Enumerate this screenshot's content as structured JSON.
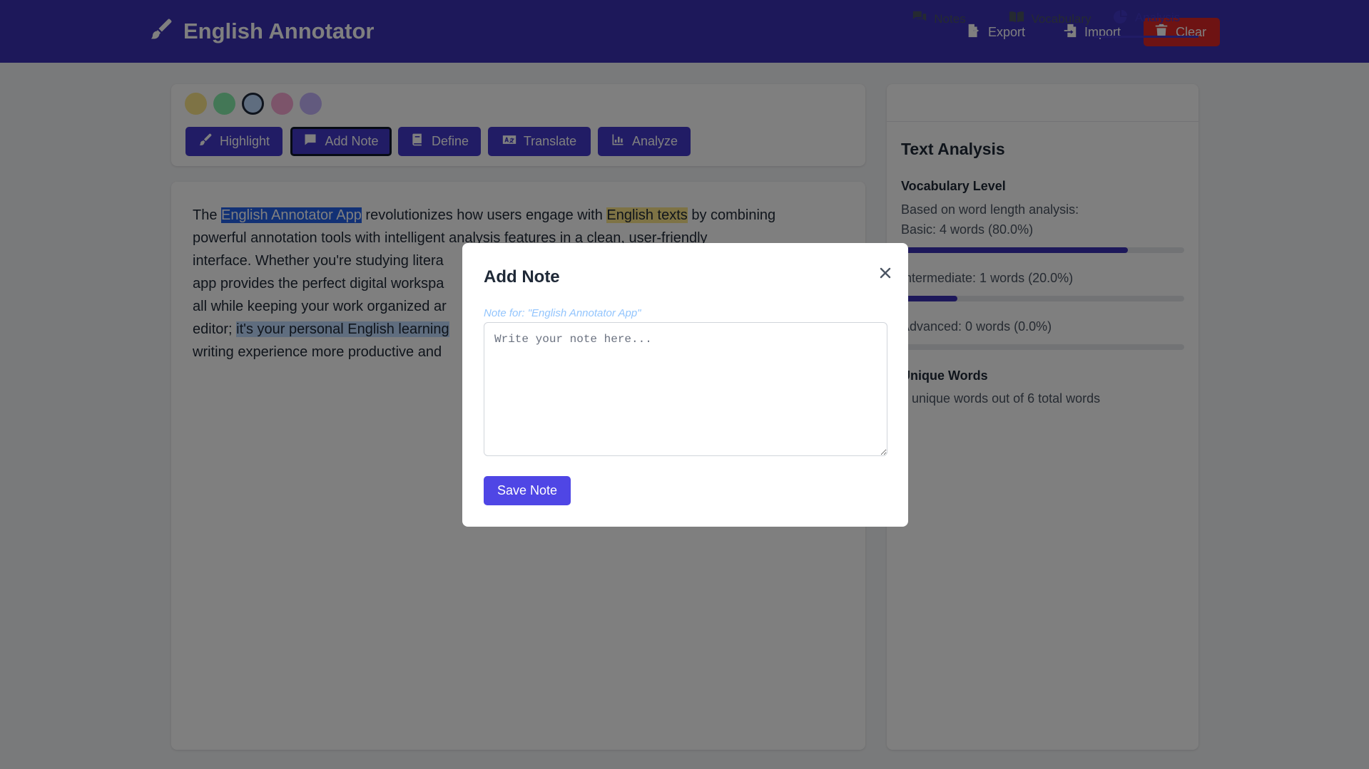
{
  "header": {
    "app_title": "English Annotator",
    "logo_icon": "brush-icon",
    "export_label": "Export",
    "import_label": "Import",
    "clear_label": "Clear"
  },
  "toolbar": {
    "colors": [
      "#fde68a",
      "#86efac",
      "#bfdbfe",
      "#f9a8d4",
      "#c4b5fd"
    ],
    "selected_color": "#bfdbfe",
    "highlight_label": "Highlight",
    "add_note_label": "Add Note",
    "define_label": "Define",
    "translate_label": "Translate",
    "analyze_label": "Analyze"
  },
  "document": {
    "segments": [
      {
        "text": "The ",
        "style": "plain"
      },
      {
        "text": "English Annotator App",
        "style": "selected"
      },
      {
        "text": " revolutionizes how users engage with ",
        "style": "plain"
      },
      {
        "text": "English texts",
        "style": "yellow"
      },
      {
        "text": " by combining powerful annotation tools with intelligent analysis features in a clean, user-friendly interface. Whether you're studying litera",
        "style": "plain"
      },
      {
        "text": " app provides the perfect digital workspa",
        "style": "plain"
      },
      {
        "text": " all while keeping your work organized ar",
        "style": "plain"
      },
      {
        "text": " editor; ",
        "style": "plain"
      },
      {
        "text": "it's your personal English learning",
        "style": "blue"
      },
      {
        "text": " writing experience more productive and",
        "style": "plain"
      }
    ],
    "line1_a": "The ",
    "line1_sel": "English Annotator App",
    "line1_b": " revolutionizes how users engage with ",
    "line1_yellow": "English texts",
    "line1_c": " by combining",
    "line2": "powerful annotation tools with intelligent analysis features in a clean, user-friendly",
    "line3": "interface. Whether you're studying litera",
    "line4": "app provides the perfect digital workspa",
    "line5": "all while keeping your work organized ar",
    "line6_a": "editor; ",
    "line6_blue": "it's your personal English learning",
    "line7": "writing experience more productive and"
  },
  "panel": {
    "tabs": [
      {
        "label": "Notes",
        "icon": "comments-icon"
      },
      {
        "label": "Vocabulary",
        "icon": "book-open-icon"
      },
      {
        "label": "Analysis",
        "icon": "chart-pie-icon",
        "active": true
      }
    ],
    "title": "Text Analysis",
    "vocab_title": "Vocabulary Level",
    "vocab_intro": "Based on word length analysis:",
    "basic_text": "Basic: 4 words (80.0%)",
    "basic_pct": 80.0,
    "intermediate_text": "Intermediate: 1 words (20.0%)",
    "intermediate_pct": 20.0,
    "advanced_text": "Advanced: 0 words (0.0%)",
    "advanced_pct": 0.0,
    "unique_title": "Unique Words",
    "unique_text": "6 unique words out of 6 total words"
  },
  "modal": {
    "title": "Add Note",
    "subtitle": "Note for: \"English Annotator App\"",
    "placeholder": "Write your note here...",
    "value": "",
    "save_label": "Save Note",
    "close_icon": "close-icon"
  }
}
